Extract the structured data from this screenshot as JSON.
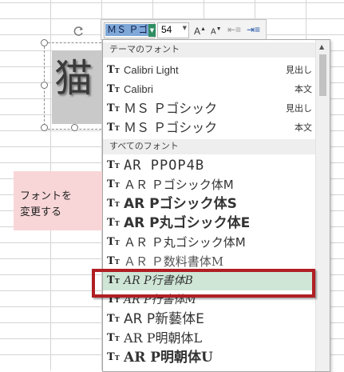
{
  "toolbar": {
    "font_value": "ＭＳ Ｐゴ",
    "size_value": "54",
    "grow_label": "A",
    "shrink_label": "A"
  },
  "textbox": {
    "glyph": "猫"
  },
  "annotation": {
    "line1": "フォントを",
    "line2": "変更する"
  },
  "dropdown": {
    "theme_header": "テーマのフォント",
    "all_header": "すべてのフォント",
    "theme_fonts": [
      {
        "name": "Calibri Light",
        "category": "見出し"
      },
      {
        "name": "Calibri",
        "category": "本文"
      },
      {
        "name": "ＭＳ Ｐゴシック",
        "category": "見出し"
      },
      {
        "name": "ＭＳ Ｐゴシック",
        "category": "本文"
      }
    ],
    "all_fonts": [
      {
        "name": "AR PPOP4B"
      },
      {
        "name": "ＡＲ Ｐゴシック体M"
      },
      {
        "name": "AR Pゴシック体S"
      },
      {
        "name": "AR P丸ゴシック体E"
      },
      {
        "name": "ＡＲ Ｐ丸ゴシック体M"
      },
      {
        "name": "ＡＲ Ｐ数料書体M"
      },
      {
        "name": "AR P行書体B"
      },
      {
        "name": "AR P行書体M"
      },
      {
        "name": "AR P新藝体E"
      },
      {
        "name": "AR P明朝体L"
      },
      {
        "name": "AR P明朝体U"
      }
    ],
    "selected_index": 6
  },
  "colors": {
    "highlight_row": "#cfe6d6",
    "callout_border": "#b01f24",
    "annotation_bg": "#f8d6d8",
    "font_selection": "#7fa8d8"
  }
}
